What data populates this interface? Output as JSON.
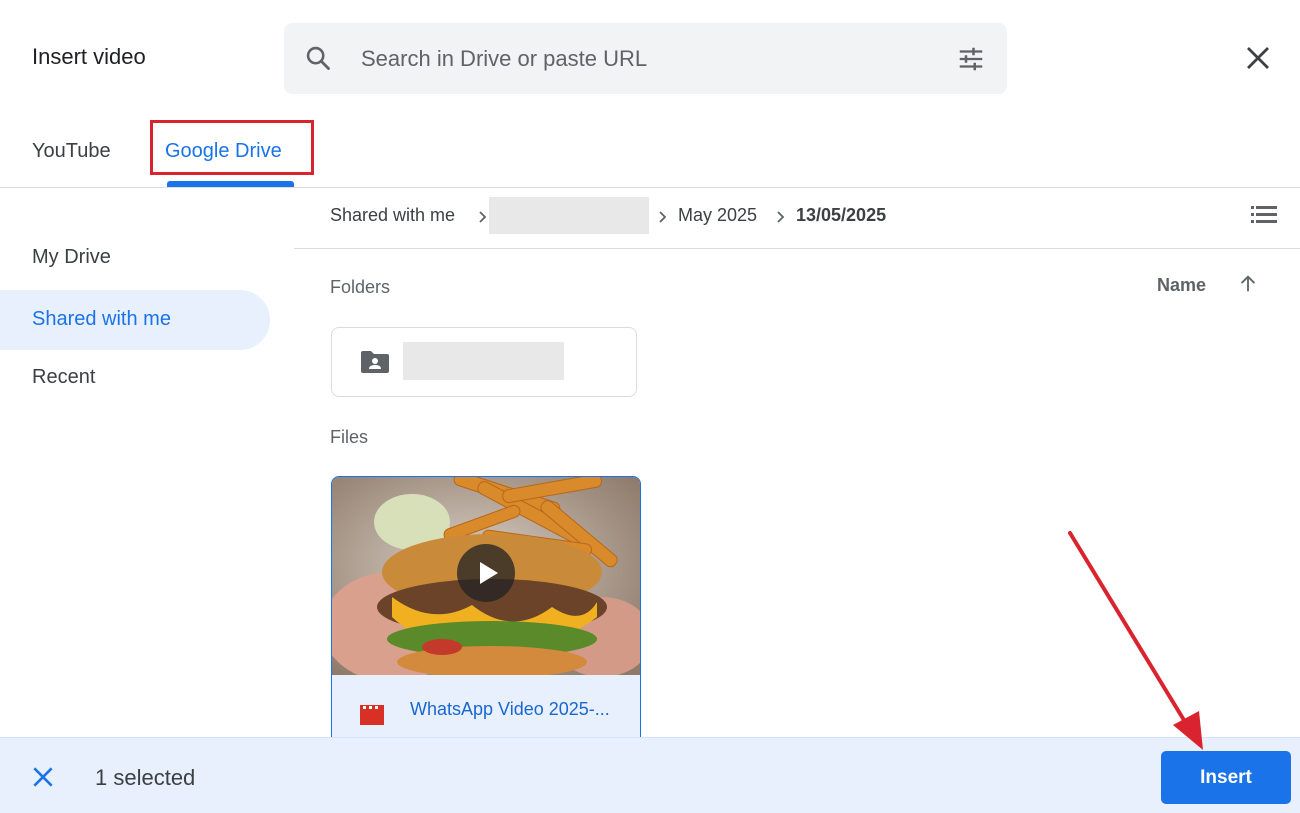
{
  "dialog": {
    "title": "Insert video"
  },
  "search": {
    "placeholder": "Search in Drive or paste URL"
  },
  "tabs": [
    {
      "label": "YouTube",
      "active": false
    },
    {
      "label": "Google Drive",
      "active": true
    }
  ],
  "sidebar": {
    "items": [
      {
        "label": "My Drive",
        "active": false
      },
      {
        "label": "Shared with me",
        "active": true
      },
      {
        "label": "Recent",
        "active": false
      }
    ]
  },
  "breadcrumb": {
    "items": [
      "Shared with me",
      "",
      "May 2025",
      "13/05/2025"
    ]
  },
  "sort": {
    "label": "Name",
    "direction": "ascending"
  },
  "sections": {
    "folders_label": "Folders",
    "files_label": "Files"
  },
  "files": [
    {
      "name": "WhatsApp Video 2025-...",
      "type": "video",
      "selected": true
    }
  ],
  "footer": {
    "selected_text": "1 selected",
    "insert_label": "Insert"
  },
  "colors": {
    "accent": "#1a73e8",
    "selection_bg": "#e8f0fe",
    "annotation": "#d9232e",
    "video_icon": "#d93025"
  },
  "icons": [
    "search-icon",
    "filter-icon",
    "close-icon",
    "list-view-icon",
    "sort-arrow-icon",
    "shared-folder-icon",
    "play-icon",
    "video-file-icon",
    "clear-selection-icon"
  ]
}
